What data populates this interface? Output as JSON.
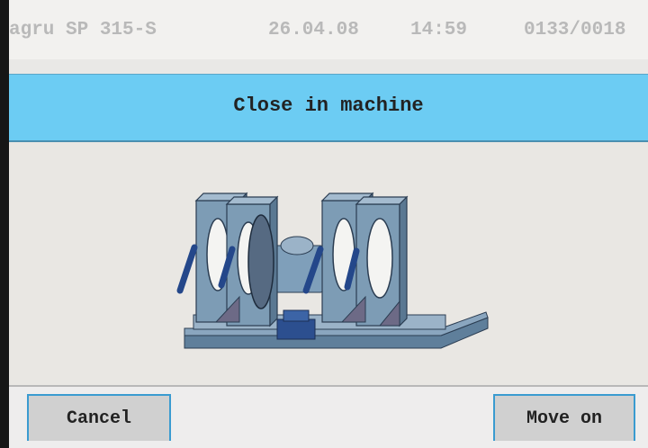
{
  "status": {
    "device": "agru SP 315-S",
    "date": "26.04.08",
    "time": "14:59",
    "counter": "0133/0018"
  },
  "title": "Close in machine",
  "illustration": {
    "icon": "welding-machine-illustration"
  },
  "buttons": {
    "cancel": "Cancel",
    "move_on": "Move on"
  },
  "colors": {
    "title_bar": "#6cccf3",
    "button_border": "#3a9bd0",
    "machine_body": "#7d9cb5"
  }
}
